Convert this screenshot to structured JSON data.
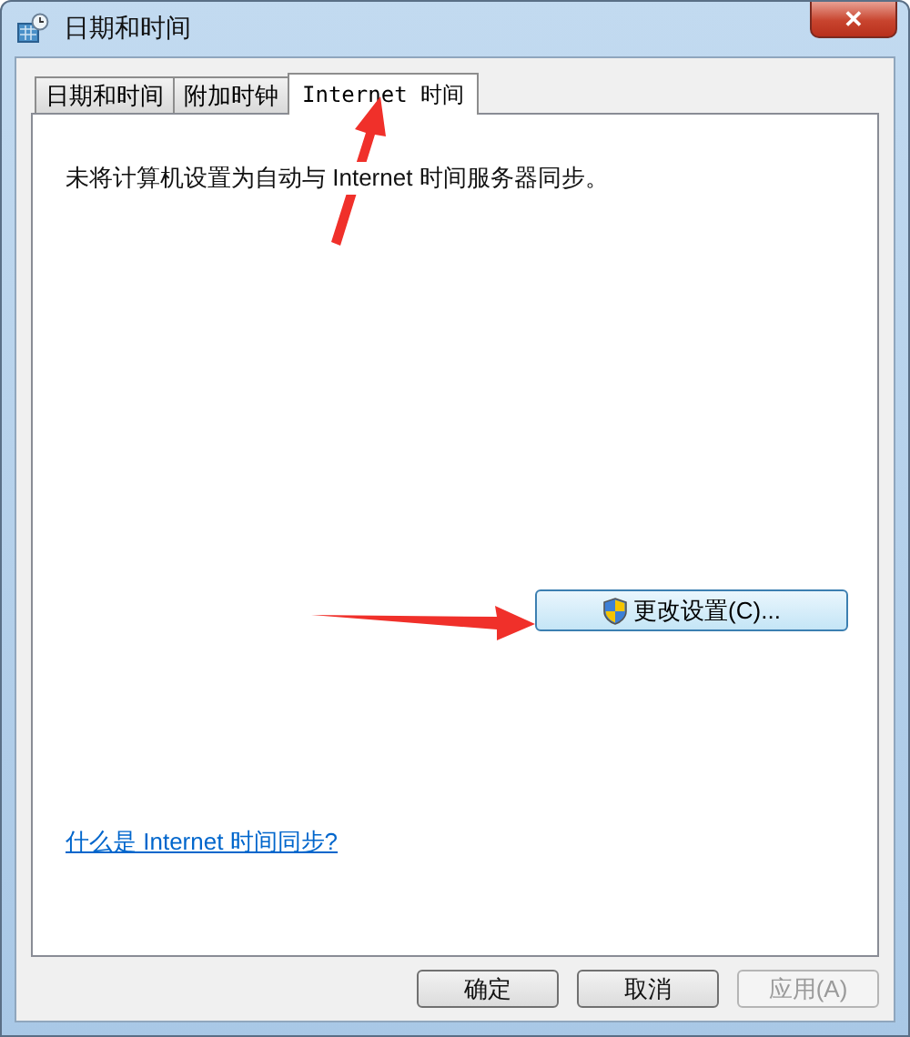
{
  "window": {
    "title": "日期和时间",
    "close": "✕"
  },
  "tabs": [
    {
      "label": "日期和时间",
      "selected": false
    },
    {
      "label": "附加时钟",
      "selected": false
    },
    {
      "label": "Internet 时间",
      "selected": true
    }
  ],
  "status_text": "未将计算机设置为自动与 Internet 时间服务器同步。",
  "change_button": "更改设置(C)...",
  "help_link": "什么是 Internet 时间同步?",
  "buttons": [
    {
      "label": "确定",
      "disabled": false
    },
    {
      "label": "取消",
      "disabled": false
    },
    {
      "label": "应用(A)",
      "disabled": true
    }
  ]
}
